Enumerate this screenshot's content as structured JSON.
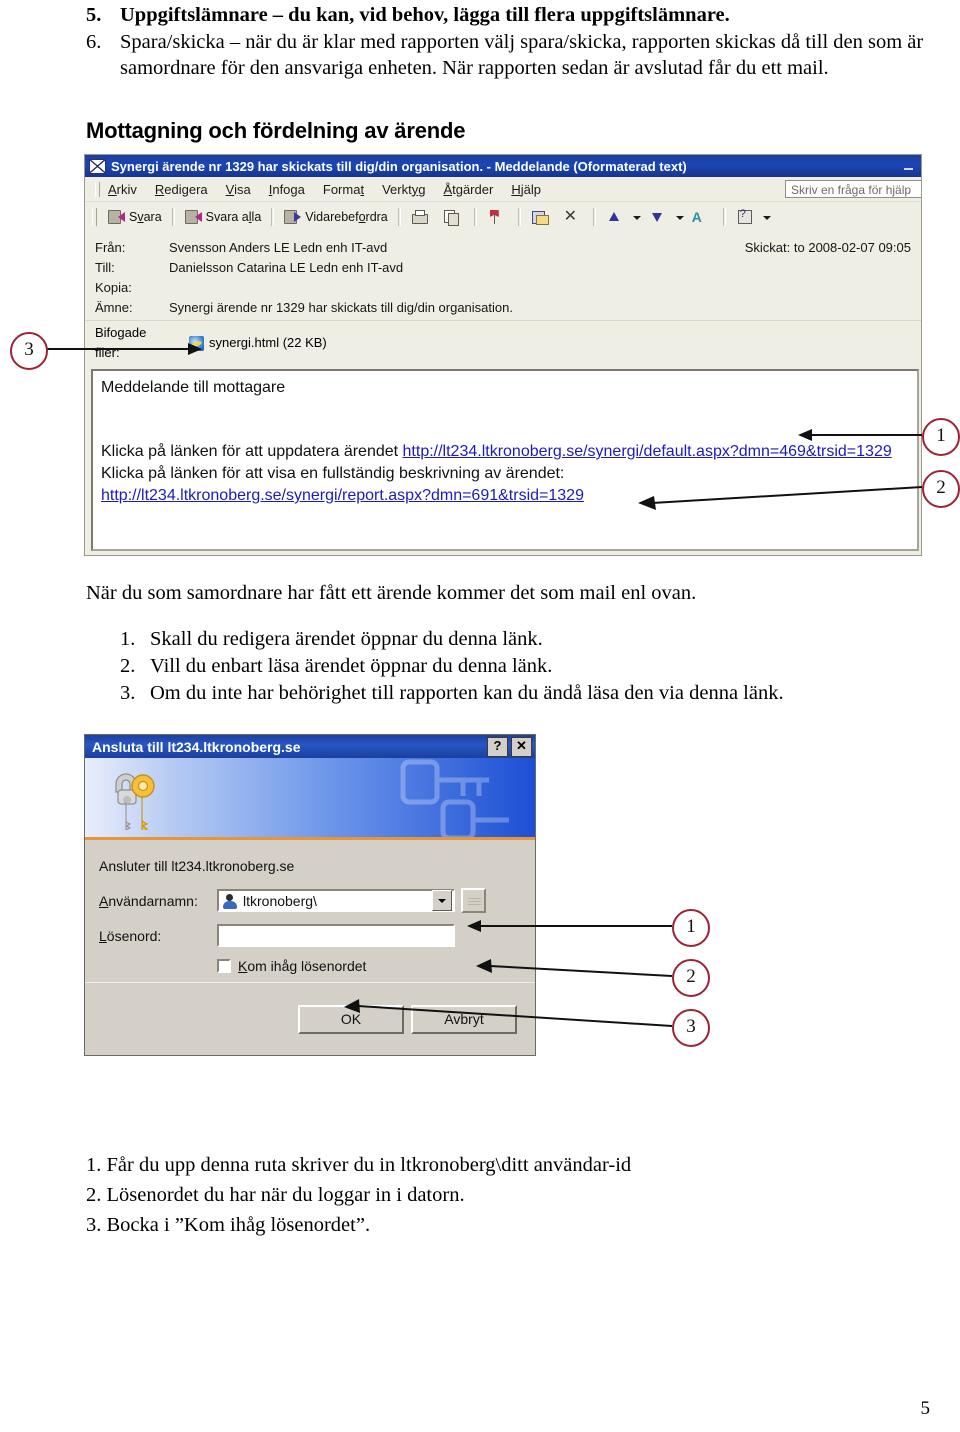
{
  "document": {
    "intro_items": [
      {
        "num": "5.",
        "text": "Uppgiftslämnare – du kan, vid behov, lägga till flera uppgiftslämnare."
      },
      {
        "num": "6.",
        "text": "Spara/skicka – när du är klar med rapporten välj spara/skicka, rapporten skickas då till den som är samordnare för den ansvariga enheten. När rapporten sedan är avslutad får du ett mail."
      }
    ],
    "section_heading": "Mottagning och fördelning av ärende",
    "mid_paragraph": "När du som samordnare har fått ett ärende kommer det som mail enl ovan.",
    "mid_list": [
      {
        "num": "1.",
        "text": "Skall du redigera ärendet öppnar du denna länk."
      },
      {
        "num": "2.",
        "text": "Vill du enbart läsa ärendet öppnar du denna länk."
      },
      {
        "num": "3.",
        "text": "Om du inte har behörighet till rapporten kan du ändå läsa den via denna länk."
      }
    ],
    "bottom_notes": [
      "1. Får du upp denna ruta skriver du in ltkronoberg\\ditt användar-id",
      "2. Lösenordet du har när du loggar in i datorn.",
      "3. Bocka i ”Kom ihåg lösenordet”."
    ],
    "page_number": "5"
  },
  "mail_window": {
    "title": "Synergi ärende nr 1329 har skickats till dig/din organisation.  - Meddelande (Oformaterad text)",
    "title_icon": "envelope-icon",
    "minimize_label": "–",
    "menu": [
      {
        "label": "Arkiv",
        "accel": "A"
      },
      {
        "label": "Redigera",
        "accel": "R"
      },
      {
        "label": "Visa",
        "accel": "V"
      },
      {
        "label": "Infoga",
        "accel": "I"
      },
      {
        "label": "Format",
        "accel": "t"
      },
      {
        "label": "Verktyg",
        "accel": "y"
      },
      {
        "label": "Åtgärder",
        "accel": "Å"
      },
      {
        "label": "Hjälp",
        "accel": "H"
      }
    ],
    "ask_box_text": "Skriv en fråga för hjälp",
    "toolbar": [
      {
        "label": "Svara",
        "icon": "reply-icon"
      },
      {
        "label": "Svara alla",
        "icon": "reply-all-icon"
      },
      {
        "label": "Vidarebefordra",
        "icon": "forward-icon"
      },
      {
        "label": "",
        "icon": "print-icon"
      },
      {
        "label": "",
        "icon": "copy-icon"
      },
      {
        "label": "",
        "icon": "flag-icon"
      },
      {
        "label": "",
        "icon": "move-to-folder-icon"
      },
      {
        "label": "",
        "icon": "delete-icon"
      },
      {
        "label": "",
        "icon": "previous-item-icon"
      },
      {
        "label": "",
        "icon": "next-item-icon"
      },
      {
        "label": "",
        "icon": "autoformat-icon"
      },
      {
        "label": "",
        "icon": "help-icon"
      }
    ],
    "headers": {
      "from_label": "Från:",
      "from_value": "Svensson Anders LE Ledn enh IT-avd",
      "sent_label": "Skickat:",
      "sent_value": "to 2008-02-07 09:05",
      "to_label": "Till:",
      "to_value": "Danielsson Catarina LE Ledn enh IT-avd",
      "cc_label": "Kopia:",
      "cc_value": "",
      "subject_label": "Ämne:",
      "subject_value": "Synergi ärende nr 1329 har skickats till dig/din organisation.",
      "attachments_label": "Bifogade filer:",
      "attachment_name": "synergi.html (22 KB)",
      "attachment_icon": "internet-document-icon"
    },
    "body": {
      "line1": "Meddelande till mottagare",
      "line2_prefix": "Klicka på länken för att uppdatera ärendet ",
      "link1": "http://lt234.ltkronoberg.se/synergi/default.aspx?dmn=469&trsid=1329",
      "line3": "Klicka på länken för att visa en fullständig beskrivning av ärendet:",
      "link2": "http://lt234.ltkronoberg.se/synergi/report.aspx?dmn=691&trsid=1329"
    }
  },
  "login_dialog": {
    "title": "Ansluta till lt234.ltkronoberg.se",
    "help_button": "?",
    "close_button": "✕",
    "banner_icon": "keys-icon",
    "subtitle": "Ansluter till lt234.ltkronoberg.se",
    "username_label": "Användarnamn:",
    "username_value": "ltkronoberg\\",
    "username_icon": "user-icon",
    "dropdown_icon": "chevron-down-icon",
    "browse_button_icon": "keyboard-icon",
    "password_label": "Lösenord:",
    "password_value": "",
    "remember_label": "Kom ihåg lösenordet",
    "remember_checked": false,
    "ok_label": "OK",
    "cancel_label": "Avbryt"
  },
  "callouts": {
    "accent_color": "#9e2233",
    "mail_attachment": "3",
    "mail_link1": "1",
    "mail_link2": "2",
    "login_username": "1",
    "login_password": "2",
    "login_remember": "3"
  }
}
